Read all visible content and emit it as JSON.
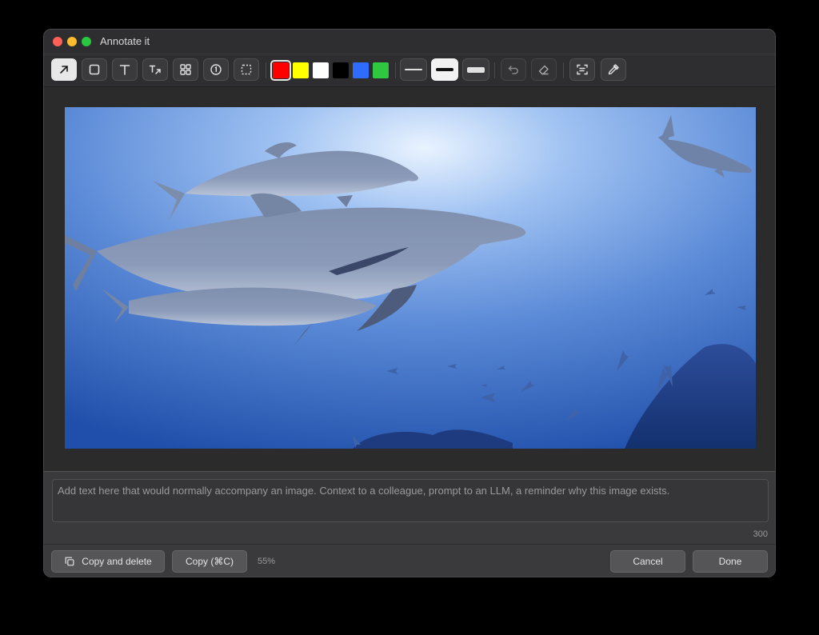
{
  "window": {
    "title": "Annotate it"
  },
  "toolbar": {
    "tools": [
      {
        "name": "arrow-tool",
        "icon": "arrow-up-right-icon",
        "active": true
      },
      {
        "name": "rectangle-tool",
        "icon": "square-icon"
      },
      {
        "name": "text-tool",
        "icon": "text-icon"
      },
      {
        "name": "text-arrow-tool",
        "icon": "text-arrow-icon"
      },
      {
        "name": "grid-tool",
        "icon": "grid-icon"
      },
      {
        "name": "counter-tool",
        "icon": "number-one-circle-icon"
      },
      {
        "name": "crop-tool",
        "icon": "dashed-select-icon"
      }
    ],
    "colors": [
      "#ff0000",
      "#ffff00",
      "#ffffff",
      "#000000",
      "#2f6bff",
      "#2ec840"
    ],
    "selected_color": "#ff0000",
    "line_widths": [
      "thin",
      "medium",
      "thick"
    ],
    "selected_width": "medium"
  },
  "notes": {
    "placeholder": "Add text here that would normally accompany an image. Context to a colleague, prompt to an LLM, a reminder why this image exists.",
    "char_limit": "300"
  },
  "footer": {
    "copy_delete_label": "Copy and delete",
    "copy_label": "Copy (⌘C)",
    "zoom": "55%",
    "cancel_label": "Cancel",
    "done_label": "Done"
  }
}
